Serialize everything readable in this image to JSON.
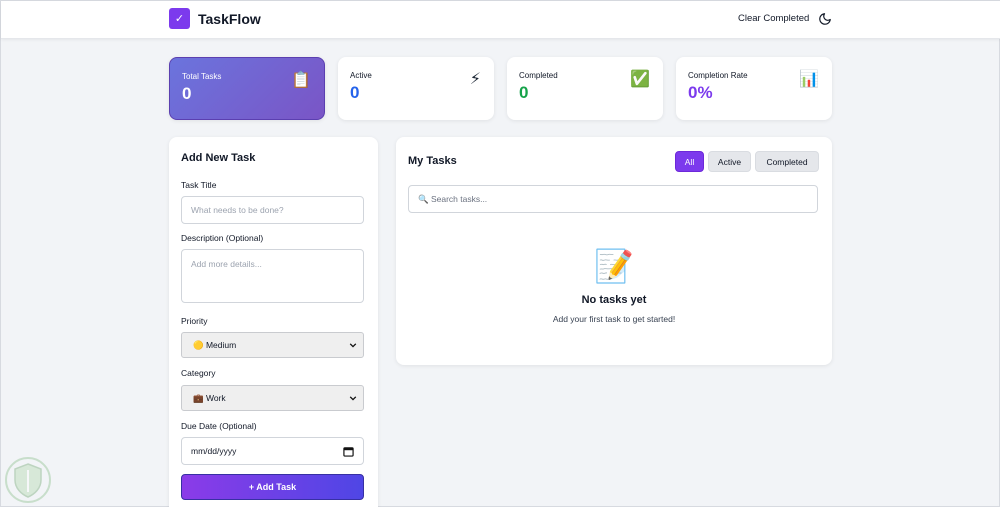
{
  "header": {
    "logo_glyph": "✓",
    "app_title": "TaskFlow",
    "clear_label": "Clear Completed",
    "theme_icon": "moon-icon"
  },
  "stats": [
    {
      "label": "Total Tasks",
      "value": "0",
      "icon": "📋",
      "color": "#ffffff"
    },
    {
      "label": "Active",
      "value": "0",
      "icon": "⚡",
      "color": "#2563eb"
    },
    {
      "label": "Completed",
      "value": "0",
      "icon": "✅",
      "color": "#16a34a"
    },
    {
      "label": "Completion Rate",
      "value": "0%",
      "icon": "📊",
      "color": "#7c3aed"
    }
  ],
  "form": {
    "title": "Add New Task",
    "task_title_label": "Task Title",
    "task_title_placeholder": "What needs to be done?",
    "description_label": "Description (Optional)",
    "description_placeholder": "Add more details...",
    "priority_label": "Priority",
    "priority_value": "🟡 Medium",
    "category_label": "Category",
    "category_value": "💼 Work",
    "due_label": "Due Date (Optional)",
    "due_value": "mm/dd/yyyy",
    "submit_label": "+ Add Task"
  },
  "tasks": {
    "title": "My Tasks",
    "filters": [
      "All",
      "Active",
      "Completed"
    ],
    "active_filter": "All",
    "search_placeholder": "🔍 Search tasks...",
    "empty_icon": "📝",
    "empty_title": "No tasks yet",
    "empty_text": "Add your first task to get started!"
  },
  "colors": {
    "accent": "#7c3aed",
    "background": "#f2f4f7"
  }
}
